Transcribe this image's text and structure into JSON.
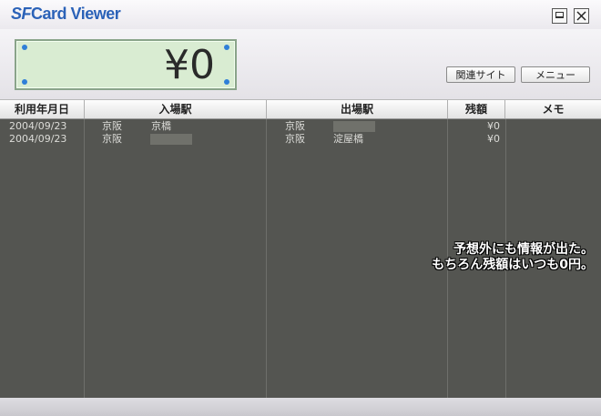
{
  "app": {
    "logo_sf": "SF",
    "logo_rest": "Card Viewer"
  },
  "balance": {
    "amount": "¥0"
  },
  "buttons": {
    "links": "関連サイト",
    "menu": "メニュー"
  },
  "table": {
    "headers": [
      "利用年月日",
      "入場駅",
      "出場駅",
      "残額",
      "メモ"
    ],
    "rows": [
      {
        "date": "2004/09/23",
        "in_company": "京阪",
        "in_station": "京橋",
        "out_company": "京阪",
        "out_station": "",
        "balance": "¥0",
        "memo": ""
      },
      {
        "date": "2004/09/23",
        "in_company": "京阪",
        "in_station": "",
        "out_company": "京阪",
        "out_station": "淀屋橋",
        "balance": "¥0",
        "memo": ""
      }
    ]
  },
  "overlay": {
    "line1": "予想外にも情報が出た。",
    "line2": "もちろん残額はいつも0円。"
  },
  "colors": {
    "logo": "#2b62b8",
    "balance_bg": "#d9ecd2",
    "table_bg": "#545551",
    "dot": "#2f7fd8"
  }
}
